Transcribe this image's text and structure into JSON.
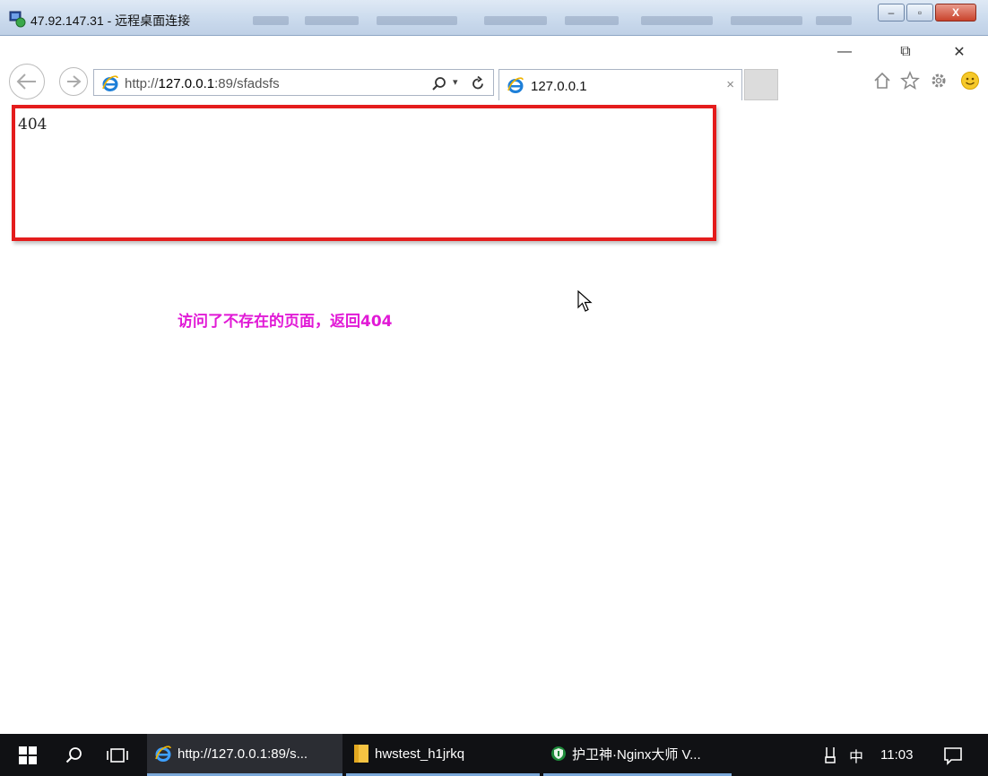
{
  "rdp": {
    "title": "47.92.147.31 - 远程桌面连接",
    "minimize": "–",
    "maximize": "▫",
    "close": "X"
  },
  "browser": {
    "url_prefix": "http://",
    "url_host": "127.0.0.1",
    "url_rest": ":89/sfadsfs",
    "search_icon": "search-icon",
    "refresh_icon": "refresh-icon",
    "tab_title": "127.0.0.1",
    "tab_close": "×",
    "window_minimize": "—",
    "window_restore": "⧉",
    "window_close": "✕"
  },
  "page": {
    "body_text": "404",
    "annotation": "访问了不存在的页面，返回404"
  },
  "taskbar": {
    "apps": [
      {
        "label": "http://127.0.0.1:89/s...",
        "icon": "ie-icon"
      },
      {
        "label": "hwstest_h1jrkq",
        "icon": "folder-icon"
      },
      {
        "label": "护卫神·Nginx大师 V...",
        "icon": "shield-icon"
      }
    ],
    "ime": "中",
    "time": "11:03"
  },
  "colors": {
    "highlight": "#e41c1c",
    "annotation": "#e11ad6",
    "taskbar": "#101114",
    "ie_blue": "#1e7fd8"
  }
}
